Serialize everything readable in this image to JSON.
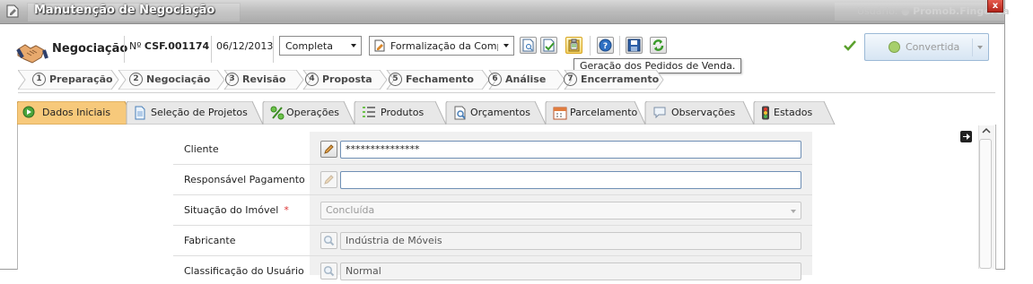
{
  "window": {
    "title": "Manutenção de Negociação",
    "user_label": "Usuário:",
    "user_name": "Promob.FingerCa",
    "close_label": "x"
  },
  "header": {
    "title": "Negociação",
    "number_prefix": "Nº",
    "number": "CSF.001174",
    "date": "06/12/2013",
    "mode_select": "Completa",
    "phase_select": "Formalização da Comp",
    "tooltip": "Geração dos Pedidos de Venda.",
    "convert_button": "Convertida",
    "accent_color": "#5aa02c"
  },
  "steps": [
    {
      "num": "1",
      "label": "Preparação"
    },
    {
      "num": "2",
      "label": "Negociação"
    },
    {
      "num": "3",
      "label": "Revisão"
    },
    {
      "num": "4",
      "label": "Proposta"
    },
    {
      "num": "5",
      "label": "Fechamento"
    },
    {
      "num": "6",
      "label": "Análise"
    },
    {
      "num": "7",
      "label": "Encerramento"
    }
  ],
  "tabs": [
    {
      "label": "Dados Iniciais",
      "icon": "start-circle-icon",
      "active": true
    },
    {
      "label": "Seleção de Projetos",
      "icon": "document-icon"
    },
    {
      "label": "Operações",
      "icon": "percent-icon"
    },
    {
      "label": "Produtos",
      "icon": "list-icon"
    },
    {
      "label": "Orçamentos",
      "icon": "magnifier-document-icon"
    },
    {
      "label": "Parcelamento",
      "icon": "calendar-icon"
    },
    {
      "label": "Observações",
      "icon": "speech-bubble-icon"
    },
    {
      "label": "Estados",
      "icon": "traffic-light-icon"
    }
  ],
  "form": {
    "cliente": {
      "label": "Cliente",
      "value": "***************"
    },
    "responsavel": {
      "label": "Responsável Pagamento",
      "value": ""
    },
    "situacao": {
      "label": "Situação do Imóvel",
      "required_mark": "*",
      "value": "Concluída"
    },
    "fabricante": {
      "label": "Fabricante",
      "value": "Indústria de Móveis"
    },
    "classificacao": {
      "label": "Classificação do Usuário",
      "value": "Normal"
    }
  }
}
